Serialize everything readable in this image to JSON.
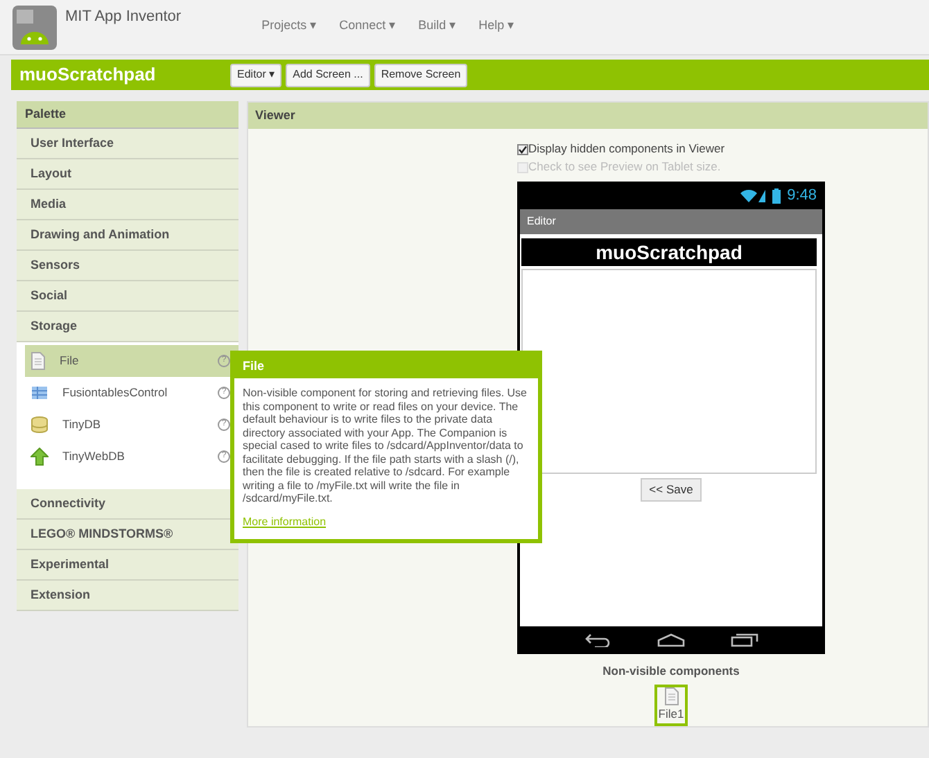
{
  "app": {
    "title": "MIT App Inventor"
  },
  "menu": [
    {
      "label": "Projects ▾"
    },
    {
      "label": "Connect ▾"
    },
    {
      "label": "Build ▾"
    },
    {
      "label": "Help ▾"
    }
  ],
  "project": {
    "name": "muoScratchpad"
  },
  "screen_buttons": [
    {
      "label": "Editor ▾"
    },
    {
      "label": "Add Screen ..."
    },
    {
      "label": "Remove Screen"
    }
  ],
  "palette": {
    "title": "Palette",
    "categories": [
      {
        "label": "User Interface"
      },
      {
        "label": "Layout"
      },
      {
        "label": "Media"
      },
      {
        "label": "Drawing and Animation"
      },
      {
        "label": "Sensors"
      },
      {
        "label": "Social"
      },
      {
        "label": "Storage",
        "items": [
          {
            "label": "File",
            "kind": "file",
            "selected": true,
            "help": "?"
          },
          {
            "label": "FusiontablesControl",
            "kind": "table",
            "selected": false,
            "help": "?"
          },
          {
            "label": "TinyDB",
            "kind": "database",
            "selected": false,
            "help": "?"
          },
          {
            "label": "TinyWebDB",
            "kind": "upload",
            "selected": false,
            "help": "?"
          }
        ]
      },
      {
        "label": "Connectivity"
      },
      {
        "label": "LEGO® MINDSTORMS®"
      },
      {
        "label": "Experimental"
      },
      {
        "label": "Extension"
      }
    ]
  },
  "tooltip": {
    "title": "File",
    "text": "Non-visible component for storing and retrieving files. Use this component to write or read files on your device. The default behaviour is to write files to the private data directory associated with your App. The Companion is special cased to write files to /sdcard/AppInventor/data to facilitate debugging. If the file path starts with a slash (/), then the file is created relative to /sdcard. For example writing a file to /myFile.txt will write the file in /sdcard/myFile.txt.",
    "link": "More information"
  },
  "viewer": {
    "title": "Viewer",
    "options": [
      {
        "label": "Display hidden components in Viewer",
        "checked": true,
        "disabled": false
      },
      {
        "label": "Check to see Preview on Tablet size.",
        "checked": false,
        "disabled": true
      }
    ],
    "phone": {
      "time": "9:48",
      "action_bar": "Editor",
      "screen_title": "muoScratchpad",
      "button": "<< Save"
    },
    "nonvisible": {
      "title": "Non-visible components",
      "items": [
        {
          "label": "File1",
          "selected": true
        }
      ]
    }
  }
}
